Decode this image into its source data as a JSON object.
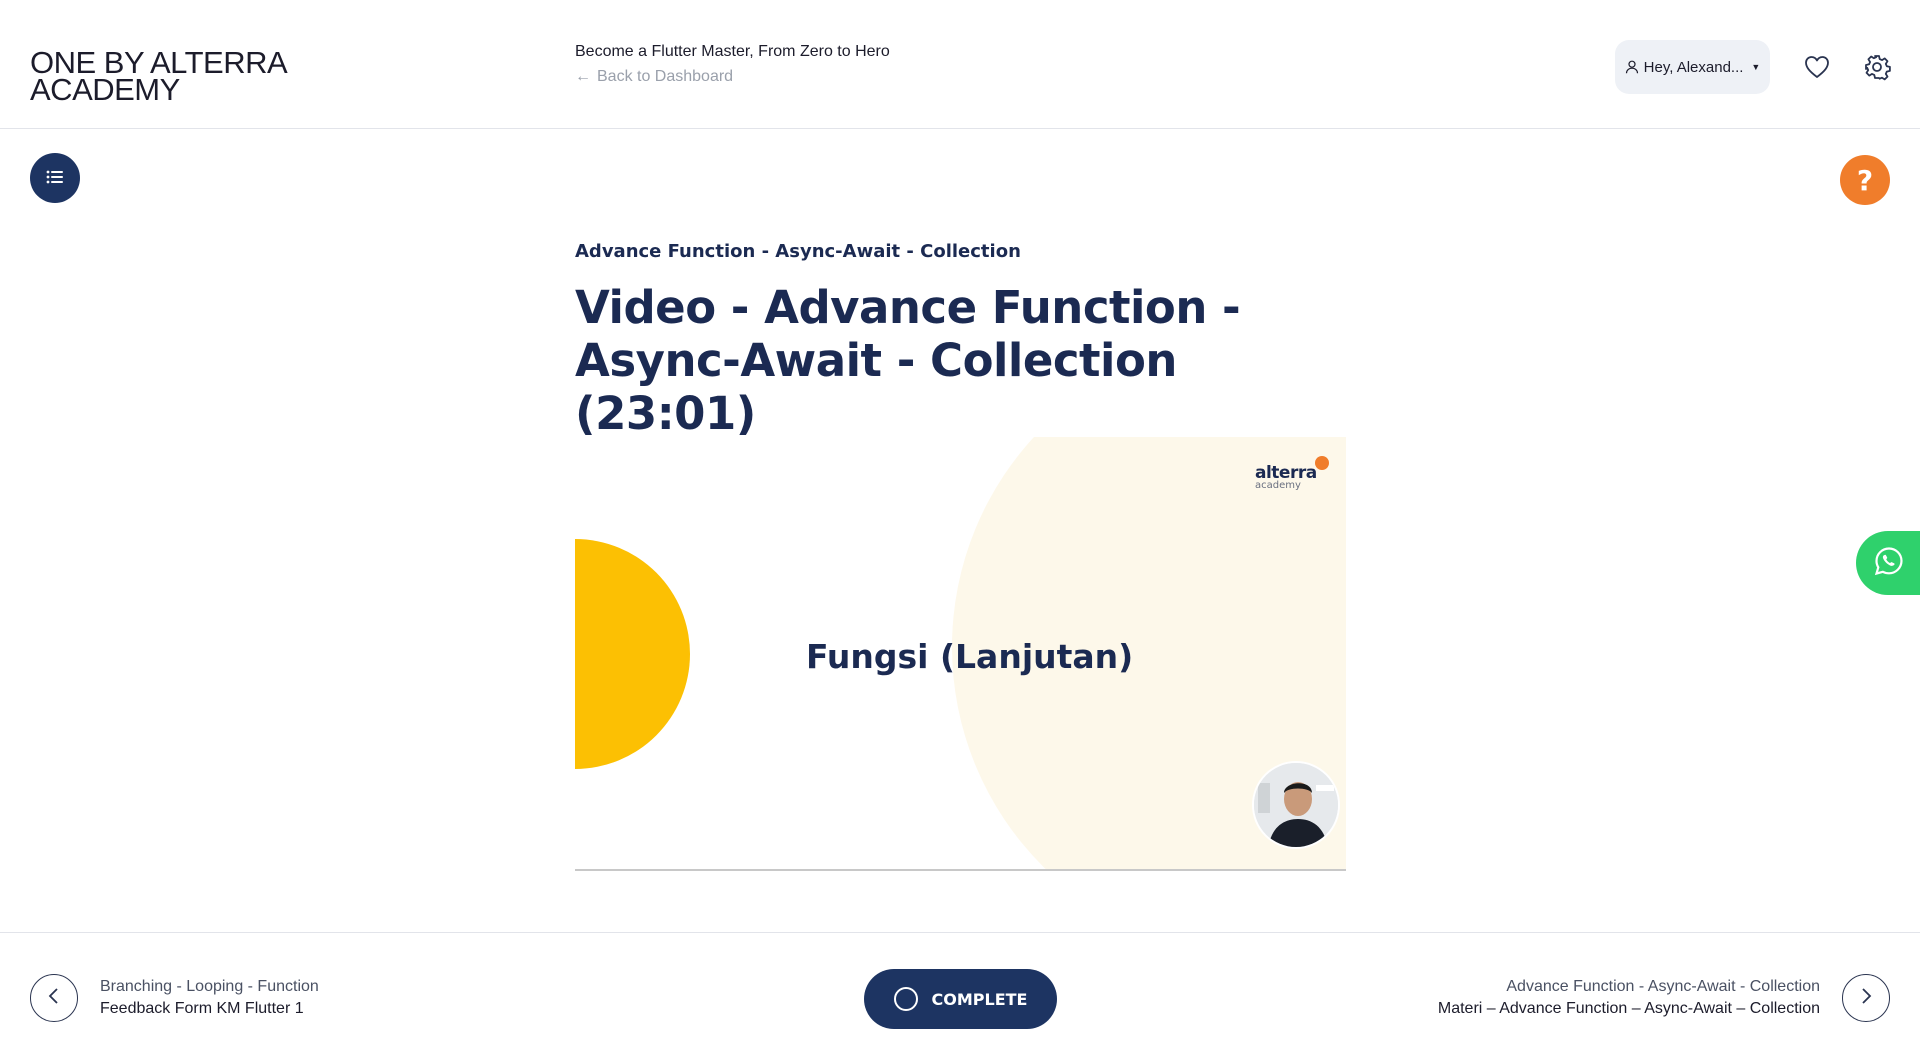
{
  "header": {
    "logo_line1": "ONE BY ALTERRA",
    "logo_line2": "ACADEMY",
    "course_title": "Become a Flutter Master, From Zero to Hero",
    "back_label": "Back to Dashboard",
    "user_label": "Hey, Alexand..."
  },
  "help": {
    "label": "?"
  },
  "content": {
    "section": "Advance Function - Async-Await - Collection",
    "title": "Video - Advance Function - Async-Await - Collection (23:01)"
  },
  "video": {
    "slide_text": "Fungsi (Lanjutan)",
    "brand": "alterra",
    "brand_sub": "academy",
    "colors": {
      "yellow": "#fcc003",
      "cream": "#fdf8ea",
      "orange": "#f07d2b"
    }
  },
  "footer": {
    "prev_sub": "Branching - Looping - Function",
    "prev_main": "Feedback Form KM Flutter 1",
    "complete_label": "COMPLETE",
    "next_sub": "Advance Function - Async-Await - Collection",
    "next_main": "Materi – Advance Function – Async-Await – Collection"
  },
  "colors": {
    "navy": "#1d3462",
    "accent": "#f07d2b",
    "whatsapp": "#2fd16c"
  }
}
